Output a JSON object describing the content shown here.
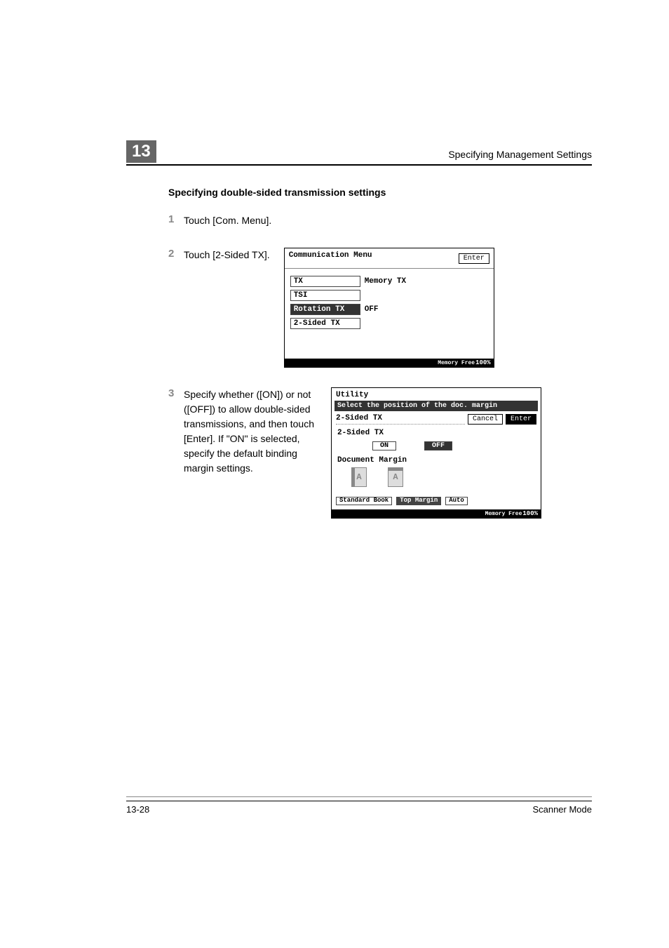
{
  "chapter": {
    "number": "13",
    "running_title": "Specifying Management Settings"
  },
  "section_title": "Specifying double-sided transmission settings",
  "steps": [
    {
      "num": "1",
      "text": "Touch [Com. Menu]."
    },
    {
      "num": "2",
      "text": "Touch [2-Sided TX]."
    },
    {
      "num": "3",
      "text": "Specify whether ([ON]) or not ([OFF]) to allow double-sided transmissions, and then touch [Enter]. If \"ON\" is selected, specify the default binding margin settings."
    }
  ],
  "screenshot1": {
    "title": "Communication Menu",
    "enter": "Enter",
    "rows": {
      "tx_label": "TX",
      "tx_val": "Memory TX",
      "tsi_label": "TSI",
      "rot_label": "Rotation TX",
      "rot_val": "OFF",
      "twosided_label": "2-Sided TX"
    },
    "footer_label": "Memory Free",
    "footer_val": "100%"
  },
  "screenshot2": {
    "utility": "Utility",
    "prompt": "Select the position of the doc. margin",
    "header_label": "2-Sided TX",
    "cancel": "Cancel",
    "enter": "Enter",
    "section_label": "2-Sided TX",
    "on": "ON",
    "off": "OFF",
    "doc_margin": "Document Margin",
    "icon_text": "A",
    "opt_std": "Standard Book",
    "opt_top": "Top Margin",
    "opt_auto": "Auto",
    "footer_label": "Memory Free",
    "footer_val": "100%"
  },
  "footer": {
    "page": "13-28",
    "mode": "Scanner Mode"
  }
}
